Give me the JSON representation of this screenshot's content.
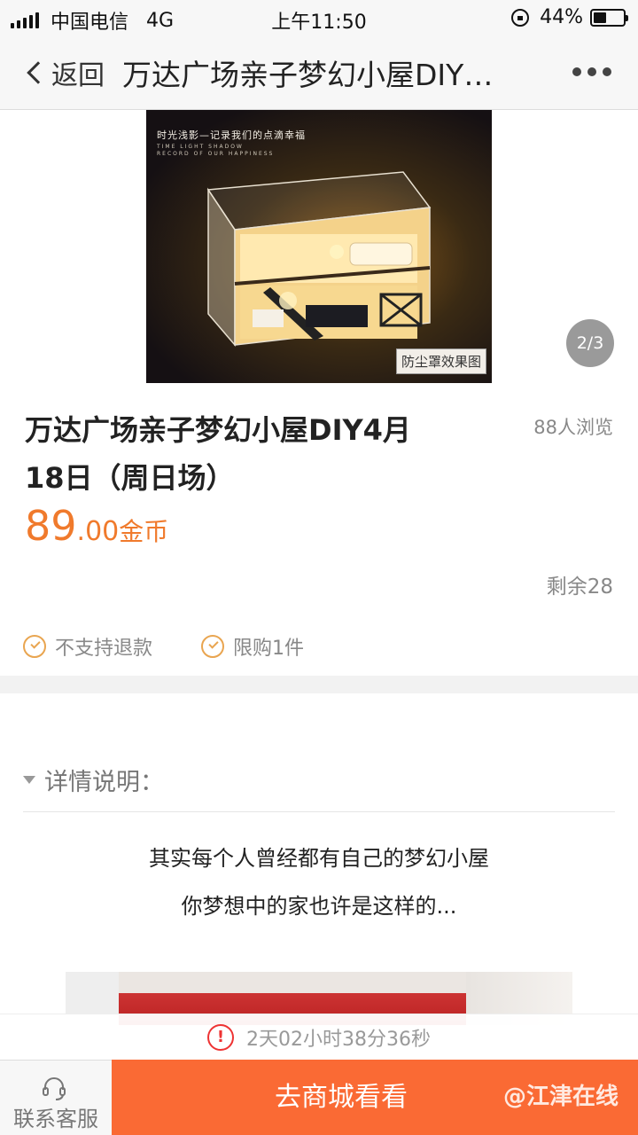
{
  "status_bar": {
    "carrier": "中国电信",
    "network": "4G",
    "time": "上午11:50",
    "battery_text": "44%",
    "battery_level": 0.44
  },
  "nav": {
    "back_label": "返回",
    "title": "万达广场亲子梦幻小屋DIY4月18日（周日场）"
  },
  "hero": {
    "overlay_text": "时光浅影—记录我们的点滴幸福",
    "overlay_sub_1": "TIME LIGHT SHADOW",
    "overlay_sub_2": "RECORD OF OUR HAPPINESS",
    "caption": "防尘罩效果图",
    "counter": "2/3"
  },
  "product": {
    "title": "万达广场亲子梦幻小屋DIY4月18日（周日场）",
    "views": "88人浏览",
    "price_int": "89",
    "price_dec": ".00",
    "price_unit": "金币",
    "remaining": "剩余28"
  },
  "tags": [
    {
      "label": "不支持退款"
    },
    {
      "label": "限购1件"
    }
  ],
  "details": {
    "heading": "详情说明：",
    "lines": [
      "其实每个人曾经都有自己的梦幻小屋",
      "你梦想中的家也许是这样的..."
    ]
  },
  "countdown": {
    "text": "2天02小时38分36秒"
  },
  "footer": {
    "service_label": "联系客服",
    "mall_label": "去商城看看",
    "watermark": "@江津在线"
  },
  "colors": {
    "accent": "#f07a2c",
    "button": "#fa6a34",
    "tag_icon": "#e9a550",
    "alert": "#e33333"
  }
}
